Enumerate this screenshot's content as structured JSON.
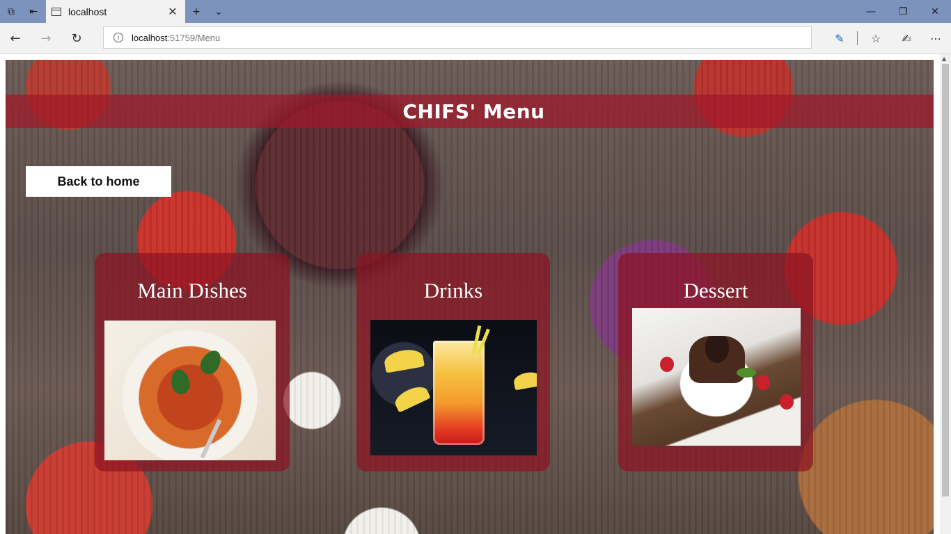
{
  "browser": {
    "tab_title": "localhost",
    "url_host": "localhost",
    "url_path": ":51759/Menu",
    "icons": [
      "tab-manager-icon",
      "set-aside-tabs-icon",
      "new-tab-icon",
      "tab-list-icon",
      "back-icon",
      "forward-icon",
      "refresh-icon",
      "info-icon",
      "read-aloud-icon",
      "favorites-icon",
      "pen-icon",
      "more-icon",
      "minimize-icon",
      "restore-icon",
      "close-icon"
    ]
  },
  "page": {
    "title": "CHIFS' Menu",
    "back_button": "Back to home",
    "categories": [
      {
        "label": "Main Dishes",
        "image": "spaghetti-bolognese"
      },
      {
        "label": "Drinks",
        "image": "sunrise-cocktail"
      },
      {
        "label": "Dessert",
        "image": "chocolate-lava-cake"
      }
    ]
  },
  "colors": {
    "banner": "#a01828",
    "card": "#8c1423",
    "titlebar": "#7c94bd"
  }
}
